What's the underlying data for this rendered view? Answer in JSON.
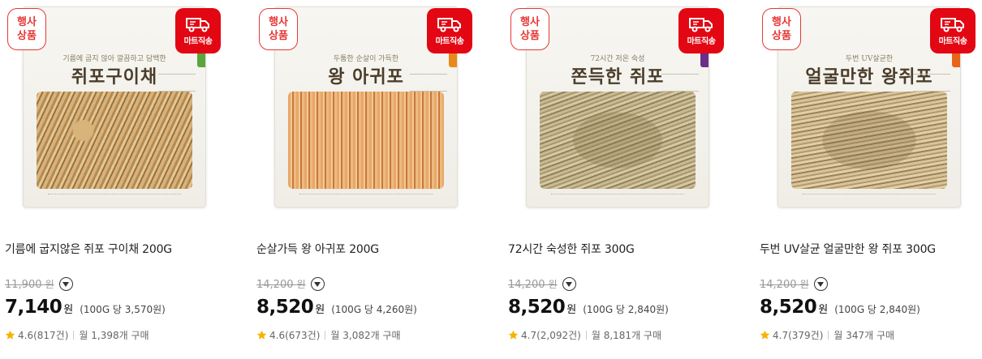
{
  "badges": {
    "event_line1": "행사",
    "event_line2": "상품",
    "mart": "마트직송"
  },
  "colors": {
    "accent": "#e30613",
    "star": "#f5b400"
  },
  "products": [
    {
      "name": "기름에 굽지않은 쥐포 구이채 200G",
      "original_price": "11,900",
      "original_won": "원",
      "price": "7,140",
      "won": "원",
      "unit_price": "(100G 당 3,570원)",
      "rating": "4.6",
      "reviews": "(817건)",
      "monthly": "월 1,398개 구매",
      "bag_sub": "기름에 굽지 않아 깔끔하고 담백한",
      "bag_title": "쥐포구이채",
      "band_color": "#5aa63c"
    },
    {
      "name": "순살가득 왕 아귀포 200G",
      "original_price": "14,200",
      "original_won": "원",
      "price": "8,520",
      "won": "원",
      "unit_price": "(100G 당 4,260원)",
      "rating": "4.6",
      "reviews": "(673건)",
      "monthly": "월 3,082개 구매",
      "bag_sub": "두툼한 순살이 가득한",
      "bag_title": "왕 아귀포",
      "band_color": "#e8891a"
    },
    {
      "name": "72시간 숙성한 쥐포 300G",
      "original_price": "14,200",
      "original_won": "원",
      "price": "8,520",
      "won": "원",
      "unit_price": "(100G 당 2,840원)",
      "rating": "4.7",
      "reviews": "(2,092건)",
      "monthly": "월 8,181개 구매",
      "bag_sub": "72시간 저온 숙성",
      "bag_title": "쫀득한 쥐포",
      "band_color": "#6a2f8a"
    },
    {
      "name": "두번 UV살균 얼굴만한 왕 쥐포 300G",
      "original_price": "14,200",
      "original_won": "원",
      "price": "8,520",
      "won": "원",
      "unit_price": "(100G 당 2,840원)",
      "rating": "4.7",
      "reviews": "(379건)",
      "monthly": "월 347개 구매",
      "bag_sub": "두번 UV살균한",
      "bag_title": "얼굴만한 왕쥐포",
      "band_color": "#e8641a"
    }
  ]
}
